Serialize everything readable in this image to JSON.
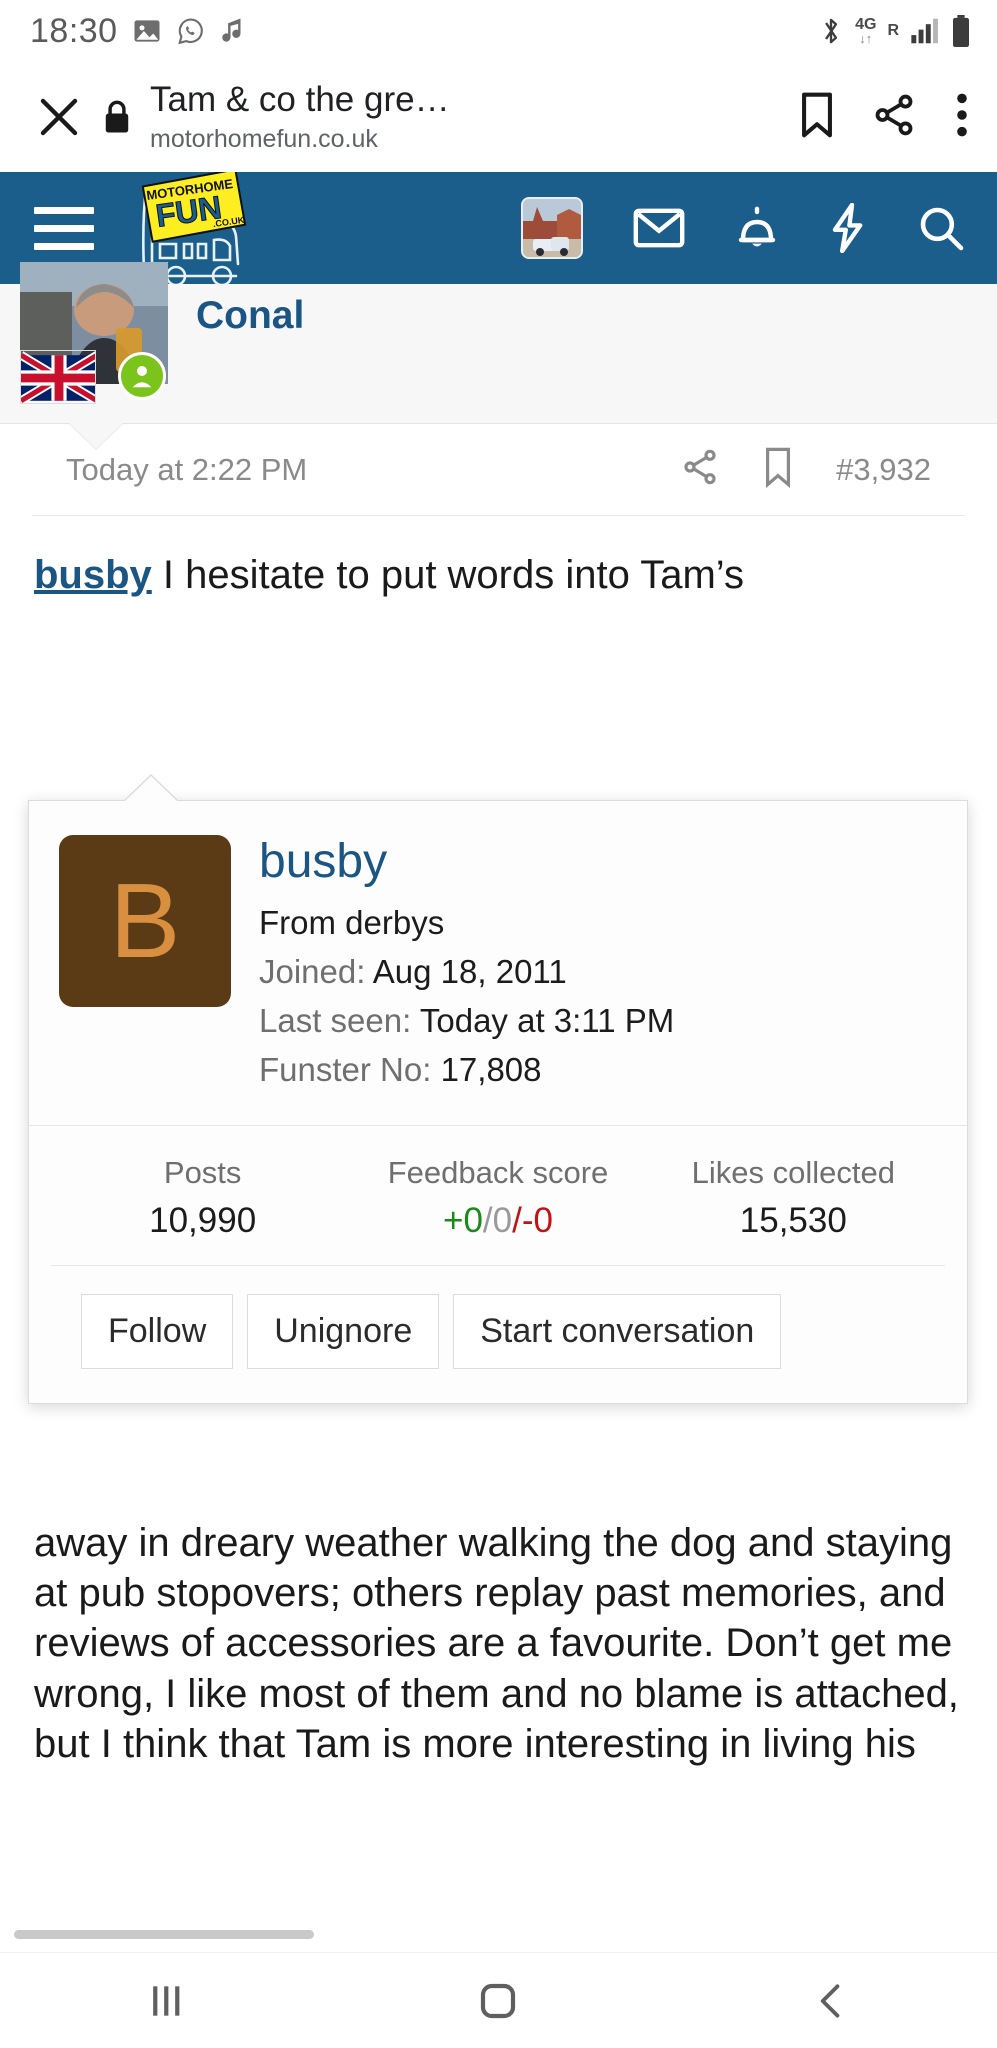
{
  "status_bar": {
    "time": "18:30",
    "left_icons": [
      "image-icon",
      "whatsapp-icon",
      "music-note-icon"
    ],
    "right_icons": [
      "bluetooth-icon",
      "4g-icon",
      "roaming-icon",
      "signal-icon",
      "battery-icon"
    ],
    "network_label": "4G",
    "roaming_label": "R"
  },
  "browser_bar": {
    "close_label": "close-icon",
    "secure_icon": "lock-icon",
    "title": "Tam & co the gre…",
    "url": "motorhomefun.co.uk",
    "actions": [
      "bookmark-icon",
      "share-icon",
      "more-vert-icon"
    ]
  },
  "site_nav": {
    "menu_label": "menu-icon",
    "logo_text_top": "MOTORHOME",
    "logo_text_main": "FUN",
    "logo_text_sub": ".CO.UK",
    "icons": [
      "user-avatar",
      "inbox-icon",
      "alerts-icon",
      "whats-new-icon",
      "search-icon"
    ],
    "background": "#1b5e8c"
  },
  "post": {
    "author": "Conal",
    "timestamp": "Today at 2:22 PM",
    "post_number": "#3,932",
    "actions": [
      "share-icon",
      "bookmark-icon"
    ],
    "mention": "busby",
    "body_line_1": " I hesitate to put words into Tam’s",
    "body_continued": "away in dreary weather walking the dog and staying at pub stopovers; others replay past memories, and reviews of accessories are a favourite. Don’t get me wrong, I like most of them and no blame is attached, but I think that Tam is more interesting in living his"
  },
  "profile_card": {
    "avatar_letter": "B",
    "avatar_bg": "#5b3a16",
    "avatar_fg": "#d88f3f",
    "username": "busby",
    "location": "From derbys",
    "joined_label": "Joined:",
    "joined_value": "Aug 18, 2011",
    "last_seen_label": "Last seen:",
    "last_seen_value": "Today at 3:11 PM",
    "funster_label": "Funster No:",
    "funster_value": "17,808",
    "stats": [
      {
        "label": "Posts",
        "value": "10,990"
      },
      {
        "label": "Feedback score",
        "positive": "+0",
        "neutral": "/0",
        "negative": "/-0"
      },
      {
        "label": "Likes collected",
        "value": "15,530"
      }
    ],
    "buttons": [
      "Follow",
      "Unignore",
      "Start conversation"
    ],
    "colors": {
      "link": "#1a5584",
      "positive": "#1a8a1a",
      "neutral": "#9a9a9a",
      "negative": "#c01414"
    }
  },
  "android_nav": {
    "recent_label": "recents-icon",
    "home_label": "home-icon",
    "back_label": "back-icon"
  }
}
